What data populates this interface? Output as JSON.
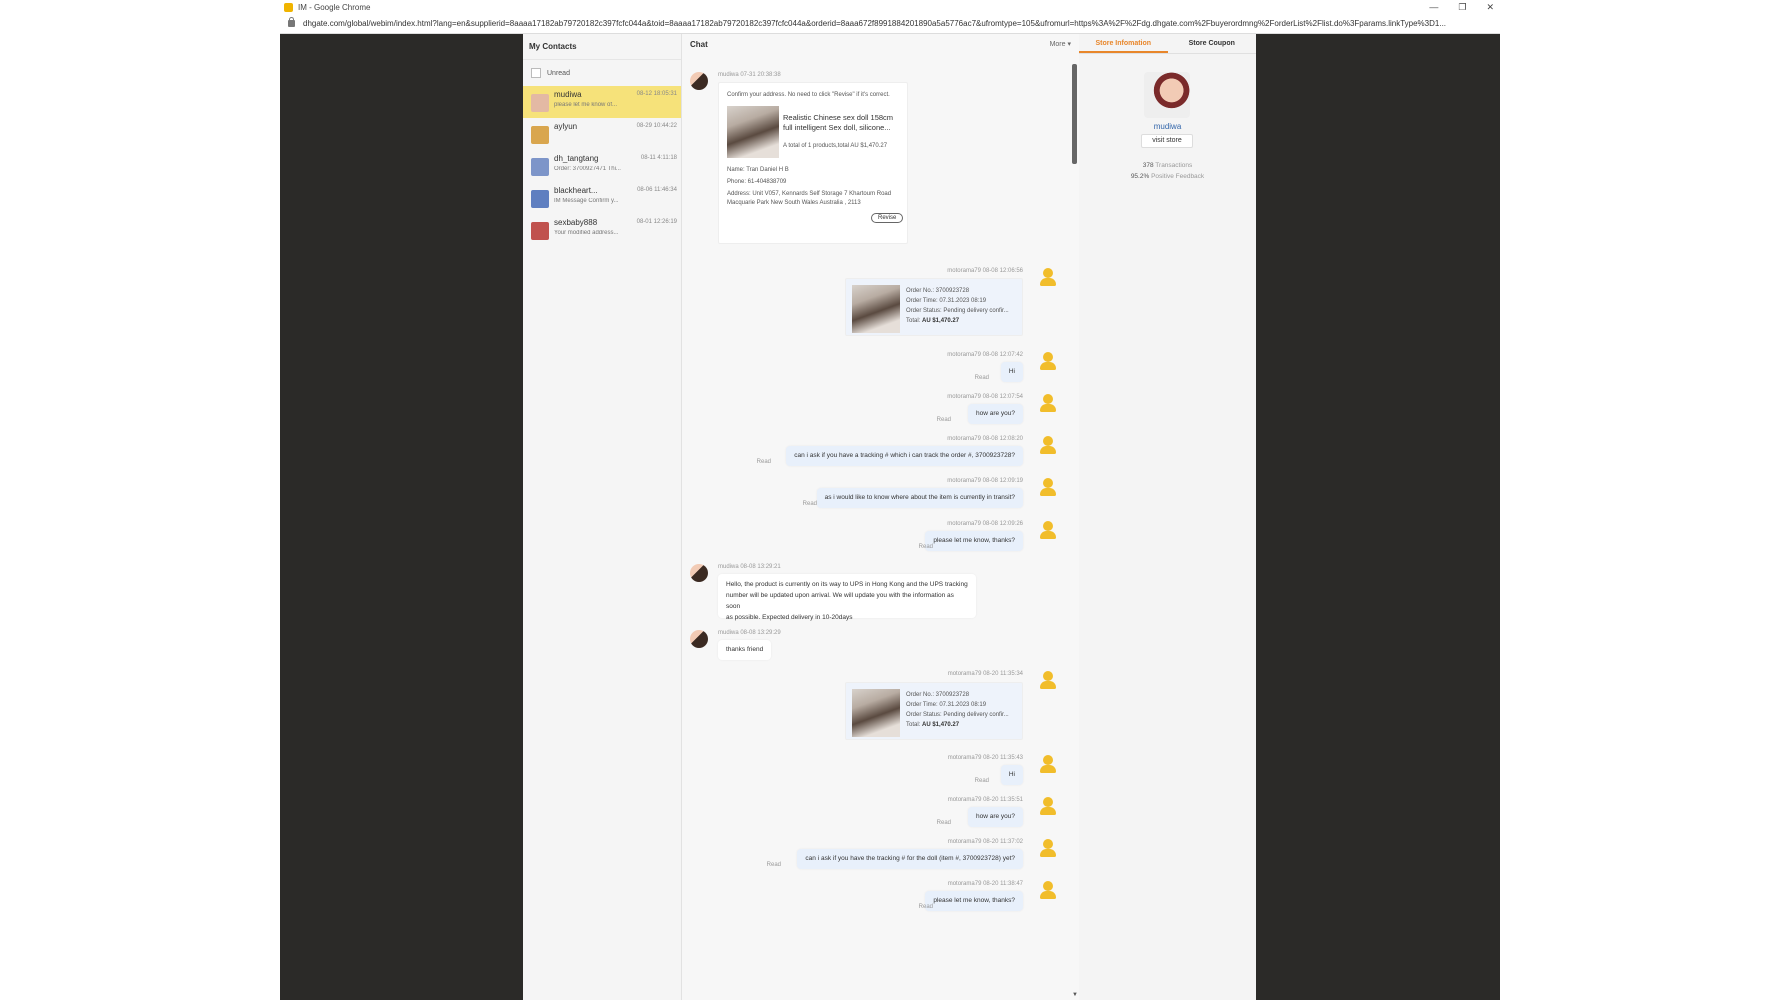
{
  "window": {
    "title": "IM - Google Chrome",
    "url": "dhgate.com/global/webim/index.html?lang=en&supplierid=8aaaa17182ab79720182c397fcfc044a&toid=8aaaa17182ab79720182c397fcfc044a&orderid=8aaa672f8991884201890a5a5776ac7&ufromtype=105&ufromurl=https%3A%2F%2Fdg.dhgate.com%2Fbuyerordmng%2ForderList%2Flist.do%3Fparams.linkType%3D1..."
  },
  "contacts": {
    "title": "My Contacts",
    "unread_label": "Unread",
    "items": [
      {
        "name": "mudiwa",
        "time": "08-12 18:05:31",
        "preview": "please let me know of...",
        "active": true,
        "avatar_color": "#e3b9a4"
      },
      {
        "name": "aylyun",
        "time": "08-29 10:44:22",
        "preview": "",
        "active": false,
        "avatar_color": "#d9a64e"
      },
      {
        "name": "dh_tangtang",
        "time": "08-11 4:11:18",
        "preview": "Order: 3700927471 Thi...",
        "active": false,
        "avatar_color": "#7d95c9"
      },
      {
        "name": "blackheart...",
        "time": "08-06 11:46:34",
        "preview": "IM Message Confirm y...",
        "active": false,
        "avatar_color": "#5f7fc0"
      },
      {
        "name": "sexbaby888",
        "time": "08-01 12:26:19",
        "preview": "Your modified address...",
        "active": false,
        "avatar_color": "#c0524e"
      }
    ]
  },
  "chat": {
    "title": "Chat",
    "more_label": "More ▾",
    "address_card": {
      "meta": "mudiwa 07-31 20:38:38",
      "confirm_text": "Confirm your address. No need to click \"Revise\" if it's correct.",
      "product_line1": "Realistic Chinese sex doll 158cm",
      "product_line2": "full intelligent Sex doll, silicone...",
      "product_total": "A total of 1 products,total AU $1,470.27",
      "name": "Name: Tran Daniel H B",
      "phone": "Phone: 61-404838709",
      "address1": "Address: Unit V057, Kennards Self Storage 7 Khartoum Road",
      "address2": "Macquarie Park New South Wales Australia , 2113",
      "revise_label": "Revise"
    },
    "order_card_a": {
      "meta": "motorama79 08-08 12:06:56",
      "order_no": "Order No.: 3700923728",
      "order_time": "Order Time: 07.31.2023 08:19",
      "order_status": "Order Status: Pending delivery confir...",
      "total_label": "Total:",
      "total_value": "AU $1,470.27"
    },
    "msg1": {
      "meta": "motorama79 08-08 12:07:42",
      "text": "Hi",
      "read": "Read"
    },
    "msg2": {
      "meta": "motorama79 08-08 12:07:54",
      "text": "how are you?",
      "read": "Read"
    },
    "msg3": {
      "meta": "motorama79 08-08 12:08:20",
      "text": "can i ask if you have a tracking # which i can track the order #, 3700923728?",
      "read": "Read"
    },
    "msg4": {
      "meta": "motorama79 08-08 12:09:19",
      "text": "as i would like to know where about the item is currently in transit?",
      "read": "Read"
    },
    "msg5": {
      "meta": "motorama79 08-08 12:09:26",
      "text": "please let me know, thanks?",
      "read": "Read"
    },
    "seller1": {
      "meta": "mudiwa 08-08 13:29:21",
      "line1": "Hello, the product is currently on its way to UPS in Hong Kong and the UPS tracking",
      "line2": "number will be updated upon arrival. We will update you with the information as soon",
      "line3": "as possible. Expected delivery in 10-20days"
    },
    "seller2": {
      "meta": "mudiwa 08-08 13:29:29",
      "text": "thanks friend"
    },
    "order_card_b": {
      "meta": "motorama79 08-20 11:35:34",
      "order_no": "Order No.: 3700923728",
      "order_time": "Order Time: 07.31.2023 08:19",
      "order_status": "Order Status: Pending delivery confir...",
      "total_label": "Total:",
      "total_value": "AU $1,470.27"
    },
    "msg6": {
      "meta": "motorama79 08-20 11:35:43",
      "text": "Hi",
      "read": "Read"
    },
    "msg7": {
      "meta": "motorama79 08-20 11:35:51",
      "text": "how are you?",
      "read": "Read"
    },
    "msg8": {
      "meta": "motorama79 08-20 11:37:02",
      "text": "can i ask if you have the tracking # for the doll (item #, 3700923728) yet?",
      "read": "Read"
    },
    "msg9": {
      "meta": "motorama79 08-20 11:38:47",
      "text": "please let me know, thanks?",
      "read": "Read"
    }
  },
  "store": {
    "tab_info": "Store Infomation",
    "tab_coupon": "Store Coupon",
    "name": "mudiwa",
    "visit_label": "visit store",
    "transactions_value": "378",
    "transactions_label": "Transactions",
    "feedback_value": "95.2%",
    "feedback_label": "Positive Feedback"
  },
  "colors": {
    "active_contact": "#f6e27a",
    "accent_orange": "#e8862a",
    "user_avatar": "#f1bd2b",
    "window_bg": "#2b2a28"
  }
}
